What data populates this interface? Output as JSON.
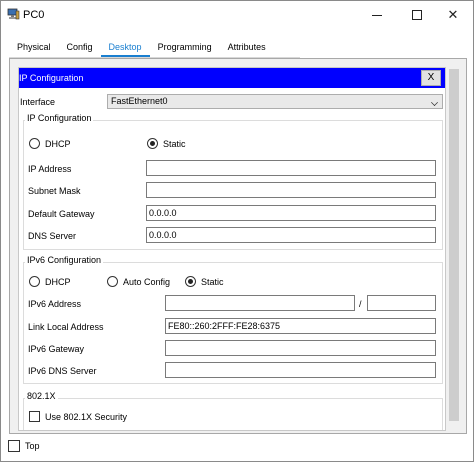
{
  "window": {
    "title": "PC0",
    "icon": "pc-app-icon",
    "controls": {
      "minimize": "minimize-icon",
      "maximize": "maximize-icon",
      "close": "✕"
    }
  },
  "tabs": [
    "Physical",
    "Config",
    "Desktop",
    "Programming",
    "Attributes"
  ],
  "active_tab": "Desktop",
  "ip_config": {
    "header_title": "IP Configuration",
    "header_close": "X",
    "interface_label": "Interface",
    "interface_value": "FastEthernet0",
    "ipv4": {
      "group_title": "IP Configuration",
      "dhcp_label": "DHCP",
      "static_label": "Static",
      "selected_mode": "Static",
      "fields": {
        "ip_address_label": "IP Address",
        "ip_address_value": "",
        "subnet_mask_label": "Subnet Mask",
        "subnet_mask_value": "",
        "default_gateway_label": "Default Gateway",
        "default_gateway_value": "0.0.0.0",
        "dns_server_label": "DNS Server",
        "dns_server_value": "0.0.0.0"
      }
    },
    "ipv6": {
      "group_title": "IPv6 Configuration",
      "dhcp_label": "DHCP",
      "auto_config_label": "Auto Config",
      "static_label": "Static",
      "selected_mode": "Static",
      "fields": {
        "ipv6_address_label": "IPv6 Address",
        "ipv6_address_value": "",
        "prefix_separator": "/",
        "prefix_value": "",
        "link_local_label": "Link Local Address",
        "link_local_value": "FE80::260:2FFF:FE28:6375",
        "ipv6_gateway_label": "IPv6 Gateway",
        "ipv6_gateway_value": "",
        "ipv6_dns_label": "IPv6 DNS Server",
        "ipv6_dns_value": ""
      }
    },
    "dot1x": {
      "group_title": "802.1X",
      "use_security_label": "Use 802.1X Security",
      "use_security_checked": false
    }
  },
  "footer": {
    "top_label": "Top",
    "top_checked": false
  },
  "colors": {
    "header_bg": "#0000ff",
    "active_tab": "#1a7fd0"
  }
}
